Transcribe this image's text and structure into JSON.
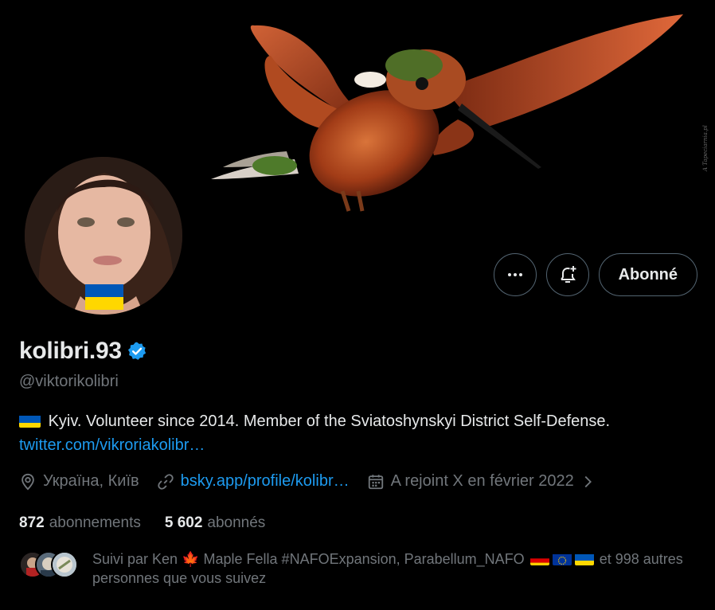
{
  "banner": {
    "watermark": "A Tapeciarnia.pl"
  },
  "actions": {
    "more_label": "Plus",
    "notify_label": "Activer les notifications",
    "follow_label": "Abonné"
  },
  "profile": {
    "display_name": "kolibri.93",
    "handle": "@viktorikolibri",
    "bio_text": "Kyiv. Volunteer since 2014. Member of the Sviatoshynskyi District Self-Defense.",
    "bio_link": "twitter.com/vikroriakolibr…",
    "location": "Україна, Київ",
    "website": "bsky.app/profile/kolibr…",
    "joined": "A rejoint X en février 2022"
  },
  "stats": {
    "following_count": "872",
    "following_label": "abonnements",
    "followers_count": "5 602",
    "followers_label": "abonnés"
  },
  "followed_by": {
    "prefix": "Suivi par Ken",
    "part2": "Maple Fella #NAFOExpansion, Parabellum_NAFO",
    "suffix": "et 998 autres personnes que vous suivez"
  },
  "colors": {
    "background": "#000000",
    "link": "#1d9bf0",
    "muted": "#71767b",
    "verified": "#1d9bf0",
    "ukraine_blue": "#0057b7",
    "ukraine_yellow": "#ffd700"
  },
  "icons": {
    "more": "more-icon",
    "notify": "bell-plus-icon",
    "verified": "verified-badge-icon",
    "location": "location-pin-icon",
    "link": "link-icon",
    "calendar": "calendar-icon",
    "chevron": "chevron-right-icon"
  }
}
